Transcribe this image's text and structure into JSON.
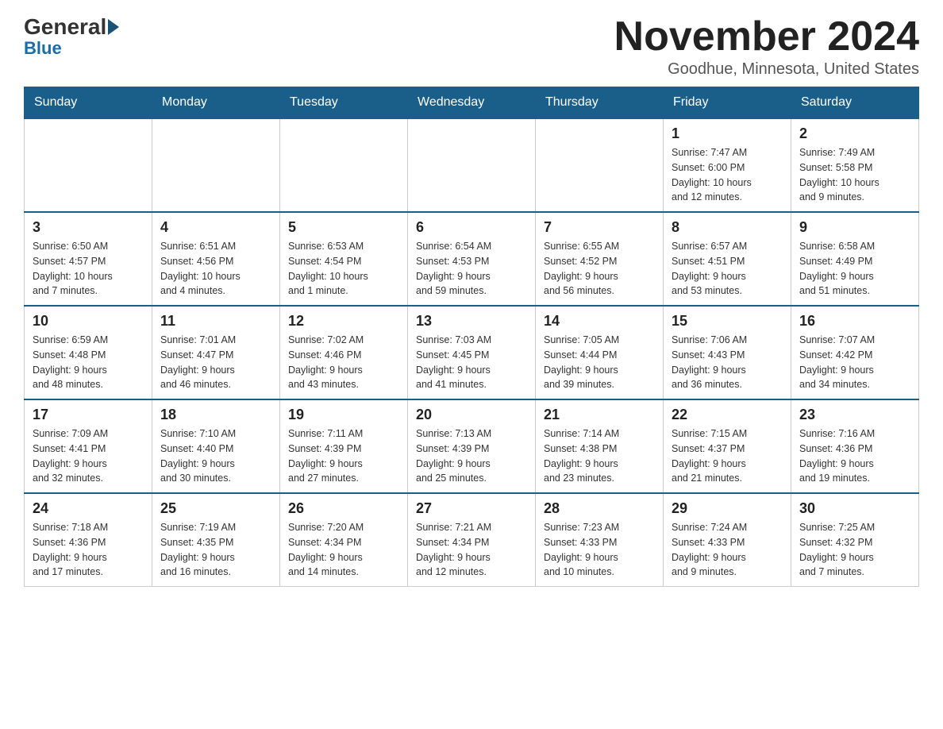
{
  "header": {
    "logo_general": "General",
    "logo_blue": "Blue",
    "month_title": "November 2024",
    "location": "Goodhue, Minnesota, United States"
  },
  "days_of_week": [
    "Sunday",
    "Monday",
    "Tuesday",
    "Wednesday",
    "Thursday",
    "Friday",
    "Saturday"
  ],
  "weeks": [
    {
      "days": [
        {
          "number": "",
          "info": ""
        },
        {
          "number": "",
          "info": ""
        },
        {
          "number": "",
          "info": ""
        },
        {
          "number": "",
          "info": ""
        },
        {
          "number": "",
          "info": ""
        },
        {
          "number": "1",
          "info": "Sunrise: 7:47 AM\nSunset: 6:00 PM\nDaylight: 10 hours\nand 12 minutes."
        },
        {
          "number": "2",
          "info": "Sunrise: 7:49 AM\nSunset: 5:58 PM\nDaylight: 10 hours\nand 9 minutes."
        }
      ]
    },
    {
      "days": [
        {
          "number": "3",
          "info": "Sunrise: 6:50 AM\nSunset: 4:57 PM\nDaylight: 10 hours\nand 7 minutes."
        },
        {
          "number": "4",
          "info": "Sunrise: 6:51 AM\nSunset: 4:56 PM\nDaylight: 10 hours\nand 4 minutes."
        },
        {
          "number": "5",
          "info": "Sunrise: 6:53 AM\nSunset: 4:54 PM\nDaylight: 10 hours\nand 1 minute."
        },
        {
          "number": "6",
          "info": "Sunrise: 6:54 AM\nSunset: 4:53 PM\nDaylight: 9 hours\nand 59 minutes."
        },
        {
          "number": "7",
          "info": "Sunrise: 6:55 AM\nSunset: 4:52 PM\nDaylight: 9 hours\nand 56 minutes."
        },
        {
          "number": "8",
          "info": "Sunrise: 6:57 AM\nSunset: 4:51 PM\nDaylight: 9 hours\nand 53 minutes."
        },
        {
          "number": "9",
          "info": "Sunrise: 6:58 AM\nSunset: 4:49 PM\nDaylight: 9 hours\nand 51 minutes."
        }
      ]
    },
    {
      "days": [
        {
          "number": "10",
          "info": "Sunrise: 6:59 AM\nSunset: 4:48 PM\nDaylight: 9 hours\nand 48 minutes."
        },
        {
          "number": "11",
          "info": "Sunrise: 7:01 AM\nSunset: 4:47 PM\nDaylight: 9 hours\nand 46 minutes."
        },
        {
          "number": "12",
          "info": "Sunrise: 7:02 AM\nSunset: 4:46 PM\nDaylight: 9 hours\nand 43 minutes."
        },
        {
          "number": "13",
          "info": "Sunrise: 7:03 AM\nSunset: 4:45 PM\nDaylight: 9 hours\nand 41 minutes."
        },
        {
          "number": "14",
          "info": "Sunrise: 7:05 AM\nSunset: 4:44 PM\nDaylight: 9 hours\nand 39 minutes."
        },
        {
          "number": "15",
          "info": "Sunrise: 7:06 AM\nSunset: 4:43 PM\nDaylight: 9 hours\nand 36 minutes."
        },
        {
          "number": "16",
          "info": "Sunrise: 7:07 AM\nSunset: 4:42 PM\nDaylight: 9 hours\nand 34 minutes."
        }
      ]
    },
    {
      "days": [
        {
          "number": "17",
          "info": "Sunrise: 7:09 AM\nSunset: 4:41 PM\nDaylight: 9 hours\nand 32 minutes."
        },
        {
          "number": "18",
          "info": "Sunrise: 7:10 AM\nSunset: 4:40 PM\nDaylight: 9 hours\nand 30 minutes."
        },
        {
          "number": "19",
          "info": "Sunrise: 7:11 AM\nSunset: 4:39 PM\nDaylight: 9 hours\nand 27 minutes."
        },
        {
          "number": "20",
          "info": "Sunrise: 7:13 AM\nSunset: 4:39 PM\nDaylight: 9 hours\nand 25 minutes."
        },
        {
          "number": "21",
          "info": "Sunrise: 7:14 AM\nSunset: 4:38 PM\nDaylight: 9 hours\nand 23 minutes."
        },
        {
          "number": "22",
          "info": "Sunrise: 7:15 AM\nSunset: 4:37 PM\nDaylight: 9 hours\nand 21 minutes."
        },
        {
          "number": "23",
          "info": "Sunrise: 7:16 AM\nSunset: 4:36 PM\nDaylight: 9 hours\nand 19 minutes."
        }
      ]
    },
    {
      "days": [
        {
          "number": "24",
          "info": "Sunrise: 7:18 AM\nSunset: 4:36 PM\nDaylight: 9 hours\nand 17 minutes."
        },
        {
          "number": "25",
          "info": "Sunrise: 7:19 AM\nSunset: 4:35 PM\nDaylight: 9 hours\nand 16 minutes."
        },
        {
          "number": "26",
          "info": "Sunrise: 7:20 AM\nSunset: 4:34 PM\nDaylight: 9 hours\nand 14 minutes."
        },
        {
          "number": "27",
          "info": "Sunrise: 7:21 AM\nSunset: 4:34 PM\nDaylight: 9 hours\nand 12 minutes."
        },
        {
          "number": "28",
          "info": "Sunrise: 7:23 AM\nSunset: 4:33 PM\nDaylight: 9 hours\nand 10 minutes."
        },
        {
          "number": "29",
          "info": "Sunrise: 7:24 AM\nSunset: 4:33 PM\nDaylight: 9 hours\nand 9 minutes."
        },
        {
          "number": "30",
          "info": "Sunrise: 7:25 AM\nSunset: 4:32 PM\nDaylight: 9 hours\nand 7 minutes."
        }
      ]
    }
  ]
}
